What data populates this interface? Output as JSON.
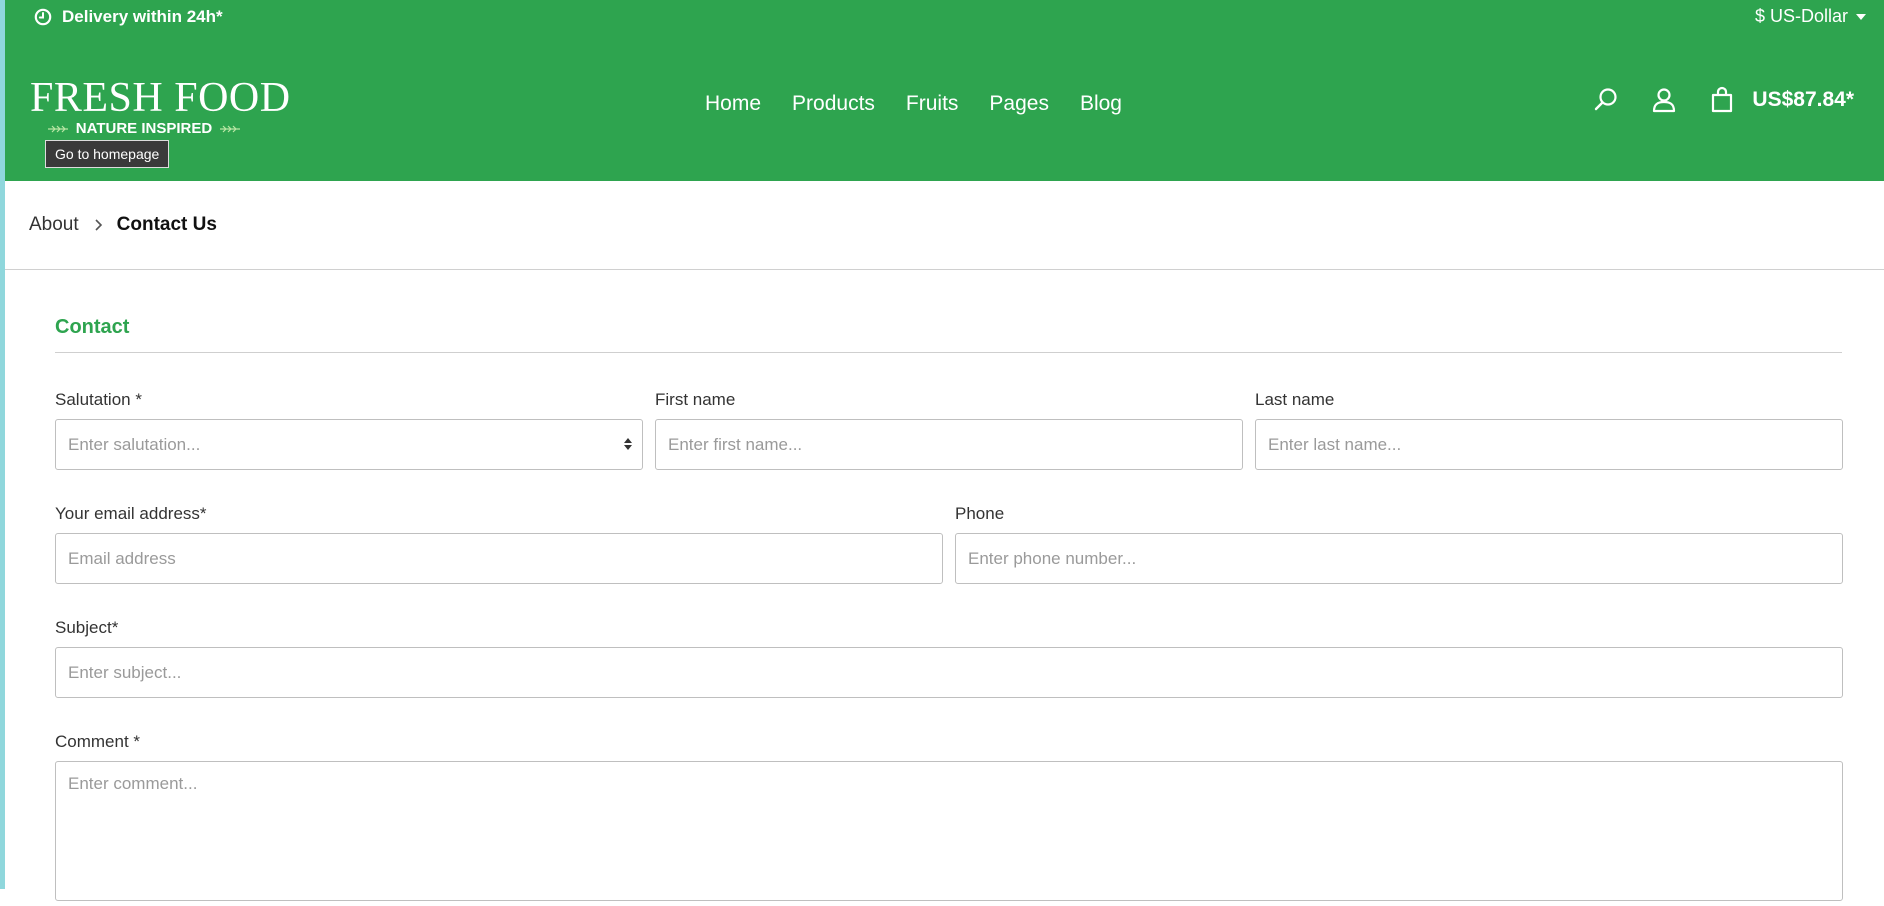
{
  "topbar": {
    "delivery": "Delivery within 24h*",
    "currency": "$ US-Dollar"
  },
  "logo": {
    "main": "FRESH FOOD",
    "sub": "NATURE INSPIRED"
  },
  "tooltip": "Go to homepage",
  "nav": [
    "Home",
    "Products",
    "Fruits",
    "Pages",
    "Blog"
  ],
  "cart_total": "US$87.84*",
  "breadcrumb": {
    "parent": "About",
    "current": "Contact Us"
  },
  "form": {
    "title": "Contact",
    "salutation": {
      "label": "Salutation *",
      "placeholder": "Enter salutation..."
    },
    "first_name": {
      "label": "First name",
      "placeholder": "Enter first name..."
    },
    "last_name": {
      "label": "Last name",
      "placeholder": "Enter last name..."
    },
    "email": {
      "label": "Your email address*",
      "placeholder": "Email address"
    },
    "phone": {
      "label": "Phone",
      "placeholder": "Enter phone number..."
    },
    "subject": {
      "label": "Subject*",
      "placeholder": "Enter subject..."
    },
    "comment": {
      "label": "Comment *",
      "placeholder": "Enter comment..."
    }
  },
  "colors": {
    "brand_green": "#2ea44f",
    "text": "#333333"
  }
}
